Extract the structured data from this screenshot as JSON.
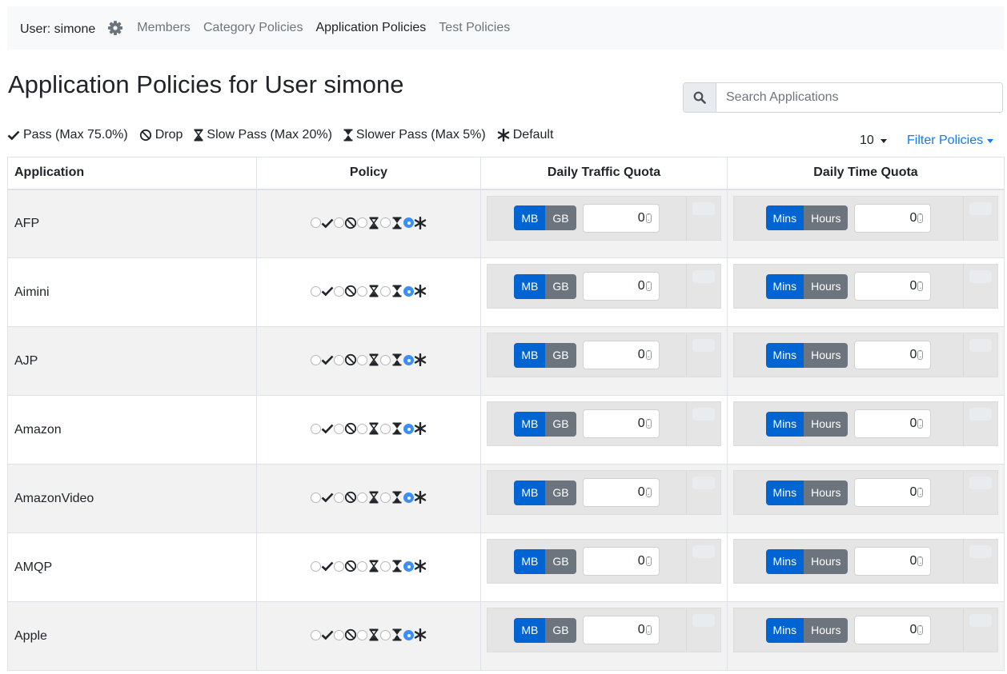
{
  "nav": {
    "user_label": "User: simone",
    "settings_icon": "gear-icon",
    "links": [
      {
        "label": "Members",
        "active": false
      },
      {
        "label": "Category Policies",
        "active": false
      },
      {
        "label": "Application Policies",
        "active": true
      },
      {
        "label": "Test Policies",
        "active": false
      }
    ]
  },
  "page": {
    "title": "Application Policies for User simone"
  },
  "search": {
    "icon": "search-icon",
    "placeholder": "Search Applications",
    "value": ""
  },
  "legend": [
    {
      "icon": "check-icon",
      "label": "Pass (Max 75.0%)"
    },
    {
      "icon": "ban-icon",
      "label": "Drop"
    },
    {
      "icon": "hourglass-half-icon",
      "label": "Slow Pass (Max 20%)"
    },
    {
      "icon": "hourglass-full-icon",
      "label": "Slower Pass (Max 5%)"
    },
    {
      "icon": "asterisk-icon",
      "label": "Default"
    }
  ],
  "pagination": {
    "page_size": "10"
  },
  "filter": {
    "label": "Filter Policies"
  },
  "table": {
    "headers": [
      "Application",
      "Policy",
      "Daily Traffic Quota",
      "Daily Time Quota"
    ],
    "traffic_units": [
      "MB",
      "GB"
    ],
    "time_units": [
      "Mins",
      "Hours"
    ],
    "rows": [
      {
        "application": "AFP",
        "policy": "default",
        "traffic_unit": "MB",
        "traffic_value": "0",
        "time_unit": "Mins",
        "time_value": "0"
      },
      {
        "application": "Aimini",
        "policy": "default",
        "traffic_unit": "MB",
        "traffic_value": "0",
        "time_unit": "Mins",
        "time_value": "0"
      },
      {
        "application": "AJP",
        "policy": "default",
        "traffic_unit": "MB",
        "traffic_value": "0",
        "time_unit": "Mins",
        "time_value": "0"
      },
      {
        "application": "Amazon",
        "policy": "default",
        "traffic_unit": "MB",
        "traffic_value": "0",
        "time_unit": "Mins",
        "time_value": "0"
      },
      {
        "application": "AmazonVideo",
        "policy": "default",
        "traffic_unit": "MB",
        "traffic_value": "0",
        "time_unit": "Mins",
        "time_value": "0"
      },
      {
        "application": "AMQP",
        "policy": "default",
        "traffic_unit": "MB",
        "traffic_value": "0",
        "time_unit": "Mins",
        "time_value": "0"
      },
      {
        "application": "Apple",
        "policy": "default",
        "traffic_unit": "MB",
        "traffic_value": "0",
        "time_unit": "Mins",
        "time_value": "0"
      }
    ]
  },
  "colors": {
    "active_toggle": "#0064d2",
    "inactive_toggle": "#6c757d",
    "selected_radio": "#3b8ef5",
    "link_blue": "#0d7bf7"
  }
}
